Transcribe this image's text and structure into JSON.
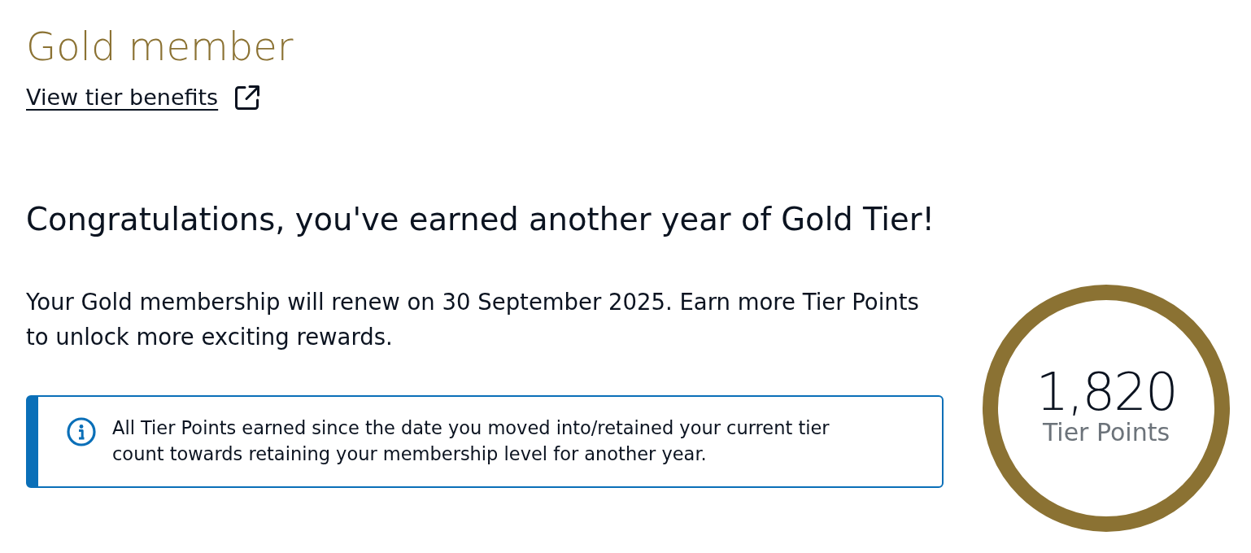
{
  "header": {
    "title": "Gold member",
    "link": {
      "label": "View tier benefits",
      "external": true
    }
  },
  "status": {
    "heading": "Congratulations, you've earned another year of Gold Tier!",
    "message": "Your Gold membership will renew on 30 September 2025. Earn more Tier Points to unlock more exciting rewards.",
    "notice": {
      "kind": "info",
      "text": "All Tier Points earned since the date you moved into/retained your current tier count towards retaining your membership level for another year."
    }
  },
  "points": {
    "value": "1,820",
    "label": "Tier Points"
  }
}
